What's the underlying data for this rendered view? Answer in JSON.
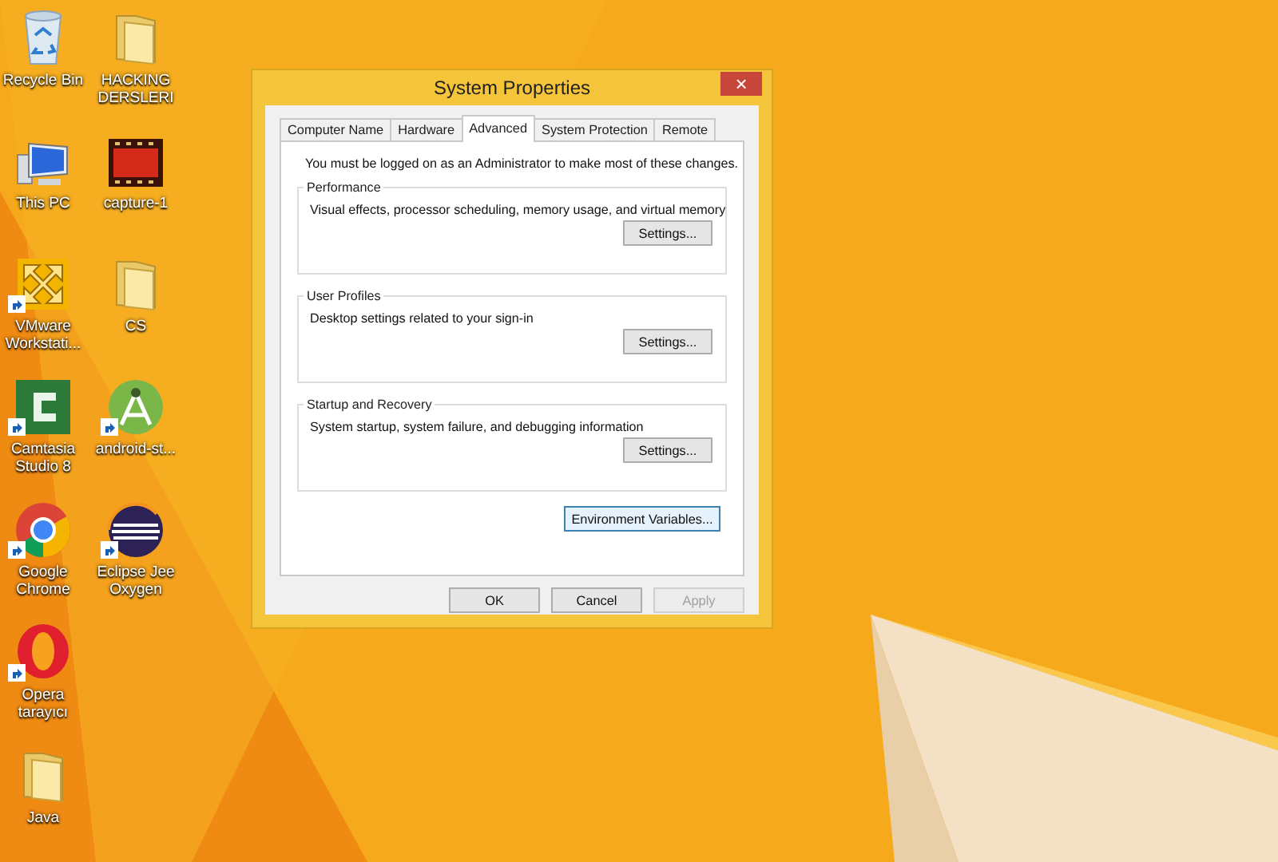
{
  "desktop_icons": [
    {
      "label": "Recycle Bin",
      "kind": "recycle-bin",
      "shortcut": false
    },
    {
      "label": "This PC",
      "kind": "computer",
      "shortcut": false
    },
    {
      "label": "VMware Workstati...",
      "kind": "vmware",
      "shortcut": true
    },
    {
      "label": "Camtasia Studio 8",
      "kind": "camtasia",
      "shortcut": true
    },
    {
      "label": "Google Chrome",
      "kind": "chrome",
      "shortcut": true
    },
    {
      "label": "Opera tarayıcı",
      "kind": "opera",
      "shortcut": true
    },
    {
      "label": "Java",
      "kind": "folder",
      "shortcut": false
    },
    {
      "label": "HACKING DERSLERI",
      "kind": "folder",
      "shortcut": false
    },
    {
      "label": "capture-1",
      "kind": "video",
      "shortcut": false
    },
    {
      "label": "CS",
      "kind": "folder",
      "shortcut": false
    },
    {
      "label": "android-st...",
      "kind": "android",
      "shortcut": true
    },
    {
      "label": "Eclipse Jee Oxygen",
      "kind": "eclipse",
      "shortcut": true
    }
  ],
  "window": {
    "title": "System Properties",
    "close": "×",
    "tabs": [
      {
        "label": "Computer Name",
        "selected": false
      },
      {
        "label": "Hardware",
        "selected": false
      },
      {
        "label": "Advanced",
        "selected": true
      },
      {
        "label": "System Protection",
        "selected": false
      },
      {
        "label": "Remote",
        "selected": false
      }
    ],
    "notice": "You must be logged on as an Administrator to make most of these changes.",
    "groups": [
      {
        "title": "Performance",
        "description": "Visual effects, processor scheduling, memory usage, and virtual memory",
        "button": "Settings..."
      },
      {
        "title": "User Profiles",
        "description": "Desktop settings related to your sign-in",
        "button": "Settings..."
      },
      {
        "title": "Startup and Recovery",
        "description": "System startup, system failure, and debugging information",
        "button": "Settings..."
      }
    ],
    "environment_button": {
      "label": "Environment Variables...",
      "focused": true
    },
    "buttons": [
      {
        "label": "OK",
        "disabled": false
      },
      {
        "label": "Cancel",
        "disabled": false
      },
      {
        "label": "Apply",
        "disabled": true
      }
    ]
  }
}
